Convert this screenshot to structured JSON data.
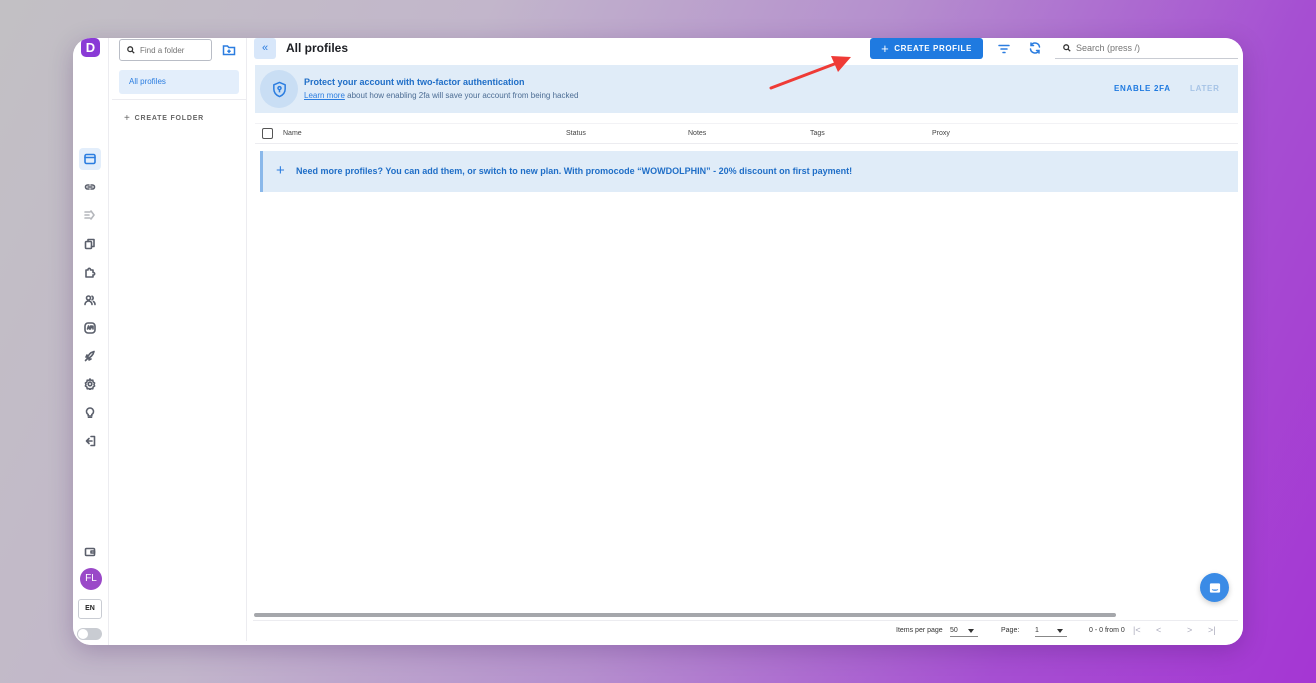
{
  "app": {
    "logo_letter": "D"
  },
  "folders": {
    "search_placeholder": "Find a folder",
    "items": [
      {
        "label": "All profiles"
      }
    ],
    "create_label": "CREATE FOLDER"
  },
  "header": {
    "collapse_glyph": "«",
    "title": "All profiles",
    "create_button": "CREATE PROFILE",
    "search_placeholder": "Search (press /)"
  },
  "banner_2fa": {
    "title": "Protect your account with two-factor authentication",
    "link_text": "Learn more",
    "subtitle_rest": " about how enabling 2fa will save your account from being hacked",
    "enable_label": "ENABLE 2FA",
    "later_label": "LATER"
  },
  "table": {
    "columns": [
      "Name",
      "Status",
      "Notes",
      "Tags",
      "Proxy"
    ]
  },
  "promo": {
    "text": "Need more profiles? You can add them, or switch to new plan. With promocode “WOWDOLPHIN” - 20% discount on first payment!"
  },
  "pagination": {
    "items_per_page_label": "Items per page",
    "items_per_page_value": "50",
    "page_label": "Page:",
    "page_value": "1",
    "range_text": "0 - 0 from 0"
  },
  "user": {
    "initials": "FL",
    "language": "EN"
  },
  "icons": {
    "rail": [
      "browser-icon",
      "link-icon",
      "automation-icon",
      "copy-icon",
      "extension-icon",
      "team-icon",
      "api-icon",
      "rocket-icon",
      "settings-icon",
      "idea-icon",
      "logout-icon",
      "wallet-icon"
    ],
    "chat": "chat-icon"
  },
  "colors": {
    "accent": "#1f7ae0",
    "banner_bg": "#e0ecf8",
    "logo": "#8a3ad6",
    "avatar": "#9a48c8",
    "annotation_arrow": "#ef3b36"
  }
}
